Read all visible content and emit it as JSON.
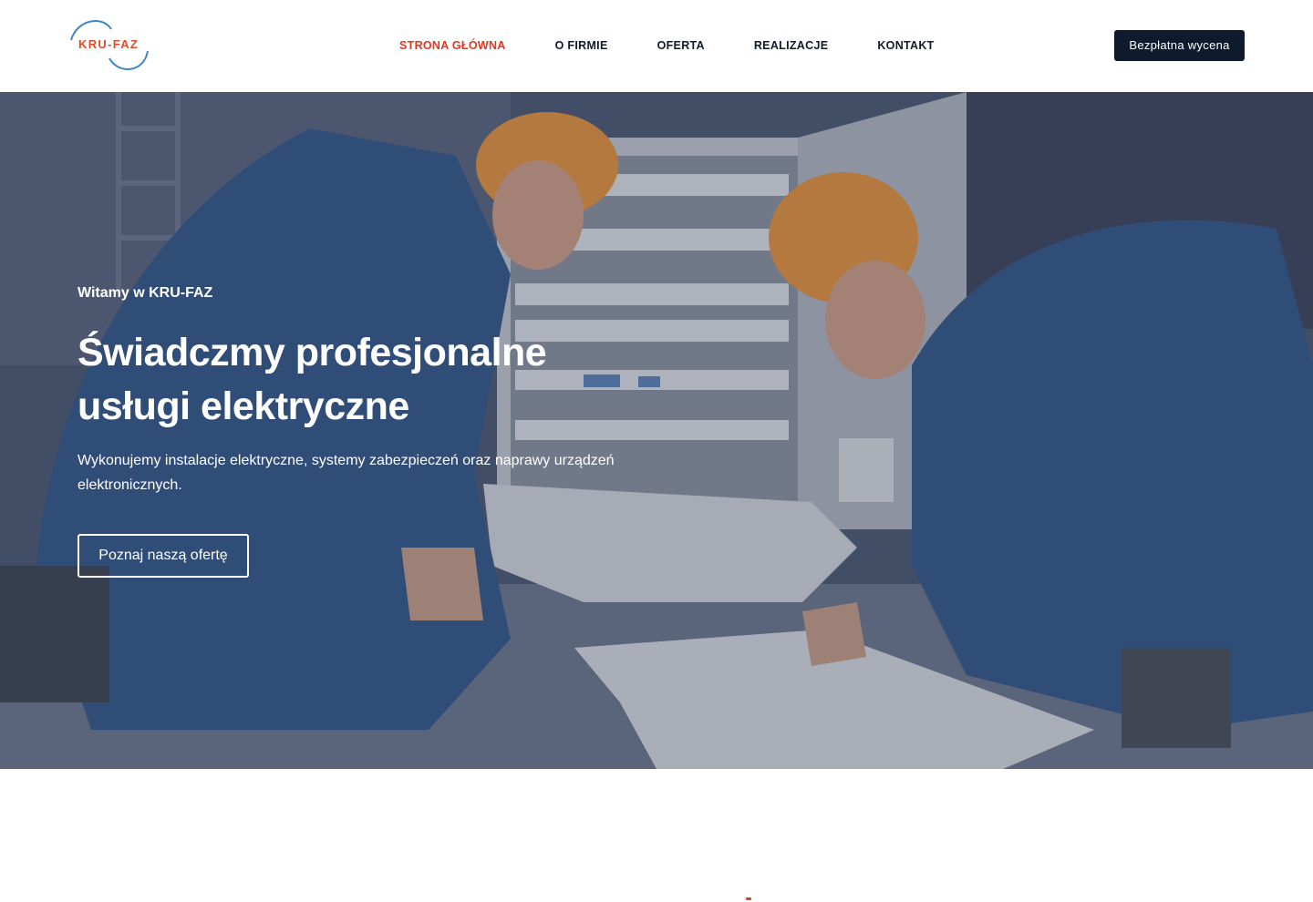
{
  "brand": {
    "logo_text": "KRU-FAZ",
    "accent_color": "#e0381c",
    "dark_color": "#0f1b2d",
    "logo_arc_color": "#3a86c8"
  },
  "nav": {
    "items": [
      {
        "label": "STRONA GŁÓWNA",
        "active": true
      },
      {
        "label": "O FIRMIE",
        "active": false
      },
      {
        "label": "OFERTA",
        "active": false
      },
      {
        "label": "REALIZACJE",
        "active": false
      },
      {
        "label": "KONTAKT",
        "active": false
      }
    ],
    "cta_label": "Bezpłatna wycena"
  },
  "hero": {
    "eyebrow": "Witamy w KRU-FAZ",
    "title": "Świadczmy profesjonalne usługi elektryczne",
    "subtitle": "Wykonujemy instalacje elektryczne, systemy zabezpieczeń oraz naprawy urządzeń elektronicznych.",
    "button_label": "Poznaj naszą ofertę",
    "image_description_icon": "electricians-photo"
  }
}
